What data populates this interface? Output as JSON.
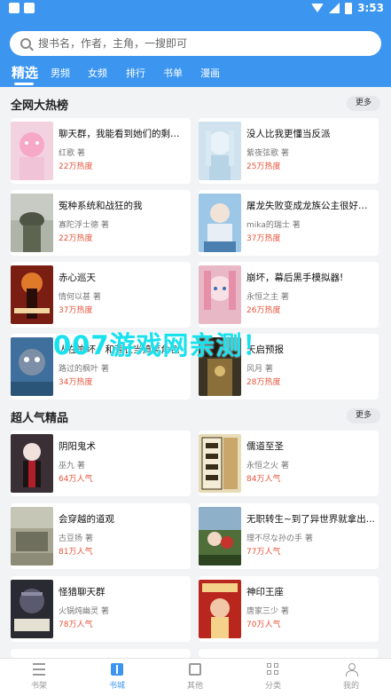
{
  "status_bar": {
    "time": "3:53"
  },
  "search": {
    "placeholder": "搜书名，作者，主角，一搜即可"
  },
  "tabs": [
    "精选",
    "男频",
    "女频",
    "排行",
    "书单",
    "漫画"
  ],
  "sections": [
    {
      "title": "全网大热榜",
      "more_label": "更多",
      "books": [
        {
          "title": "聊天群，我能看到她们的剩余...",
          "author": "红歌 著",
          "stat": "22万热度",
          "cover_color": "#f3d2df",
          "cover_text": ""
        },
        {
          "title": "没人比我更懂当反派",
          "author": "紫夜弦歌 著",
          "stat": "25万热度",
          "cover_color": "#cfe2ee",
          "cover_text": ""
        },
        {
          "title": "冤种系统和战狂的我",
          "author": "寡陀浮士德 著",
          "stat": "22万热度",
          "cover_color": "#7d8570",
          "cover_text": ""
        },
        {
          "title": "屠龙失败变成龙族公主很好笑...",
          "author": "mika的瑞士 著",
          "stat": "37万热度",
          "cover_color": "#9dc7e6",
          "cover_text": ""
        },
        {
          "title": "赤心巡天",
          "author": "情何以甚 著",
          "stat": "37万热度",
          "cover_color": "#7a1e14",
          "cover_text": ""
        },
        {
          "title": "崩坏，幕后黑手模拟器!",
          "author": "永恒之主 著",
          "stat": "26万热度",
          "cover_color": "#e9b8c6",
          "cover_text": ""
        },
        {
          "title": "人在崩坏，和芽衣当搞笑角色",
          "author": "路过的枫叶 著",
          "stat": "34万热度",
          "cover_color": "#3f6f9c",
          "cover_text": ""
        },
        {
          "title": "天启预报",
          "author": "风月 著",
          "stat": "28万热度",
          "cover_color": "#3b3424",
          "cover_text": ""
        }
      ]
    },
    {
      "title": "超人气精品",
      "more_label": "更多",
      "books": [
        {
          "title": "阴阳鬼术",
          "author": "巫九 著",
          "stat": "64万人气",
          "cover_color": "#3a2f34",
          "cover_text": ""
        },
        {
          "title": "儒道至圣",
          "author": "永恒之火 著",
          "stat": "84万人气",
          "cover_color": "#e8dcb8",
          "cover_text": ""
        },
        {
          "title": "会穿越的道观",
          "author": "古豆扬 著",
          "stat": "81万人气",
          "cover_color": "#a5a591",
          "cover_text": ""
        },
        {
          "title": "无职转生~到了异世界就拿出...",
          "author": "理不尽な孙の手 著",
          "stat": "77万人气",
          "cover_color": "#4f6e3a",
          "cover_text": ""
        },
        {
          "title": "怪猎聊天群",
          "author": "火锅炖幽灵 著",
          "stat": "78万人气",
          "cover_color": "#2a2a33",
          "cover_text": ""
        },
        {
          "title": "神印王座",
          "author": "唐家三少 著",
          "stat": "70万人气",
          "cover_color": "#b8261d",
          "cover_text": ""
        }
      ]
    }
  ],
  "watermark": "007游戏网亲测！",
  "bottom_nav": [
    {
      "label": "书架",
      "icon": "bookshelf-icon"
    },
    {
      "label": "书城",
      "icon": "book-open-icon"
    },
    {
      "label": "其他",
      "icon": "box-icon"
    },
    {
      "label": "分类",
      "icon": "grid-icon"
    },
    {
      "label": "我的",
      "icon": "user-icon"
    }
  ],
  "colors": {
    "accent": "#3c96f0",
    "heat": "#e5543b",
    "background": "#f2f3f5",
    "watermark": "#19e1ee"
  }
}
